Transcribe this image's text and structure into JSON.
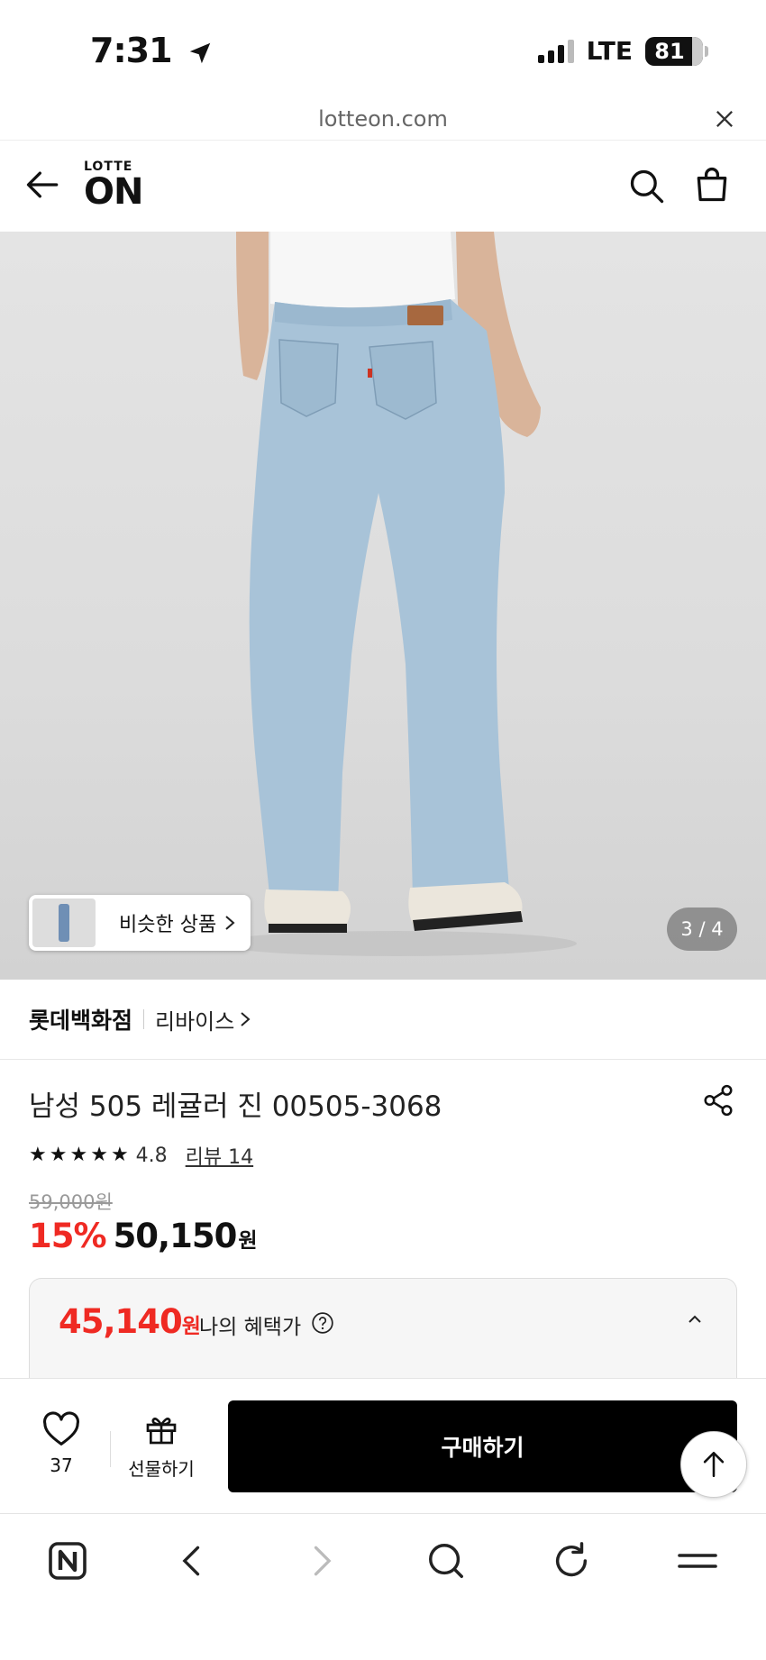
{
  "status_bar": {
    "time": "7:31",
    "network": "LTE",
    "battery": "81"
  },
  "browser": {
    "url": "lotteon.com"
  },
  "header": {
    "logo_top": "LOTTE",
    "logo_main": "ON"
  },
  "gallery": {
    "similar_label": "비슷한 상품",
    "page_indicator": "3 / 4"
  },
  "store": {
    "name": "롯데백화점",
    "brand": "리바이스"
  },
  "product": {
    "title": "남성 505 레귤러 진 00505-3068",
    "rating": "4.8",
    "stars": 5,
    "review_link": "리뷰 14",
    "original_price": "59,000원",
    "discount_rate": "15%",
    "sale_price": "50,150",
    "sale_unit": "원"
  },
  "benefit": {
    "price": "45,140",
    "unit": "원",
    "label": "나의 혜택가"
  },
  "action_bar": {
    "like_count": "37",
    "gift_label": "선물하기",
    "buy_label": "구매하기"
  },
  "colors": {
    "accent_red": "#ef2a23",
    "buy_button": "#000000"
  },
  "icons": {
    "header": [
      "back-arrow-icon",
      "search-icon",
      "shopping-bag-icon"
    ],
    "browser_toolbar": [
      "naver-icon",
      "back-icon",
      "forward-icon",
      "search-icon",
      "reload-icon",
      "menu-icon"
    ]
  }
}
